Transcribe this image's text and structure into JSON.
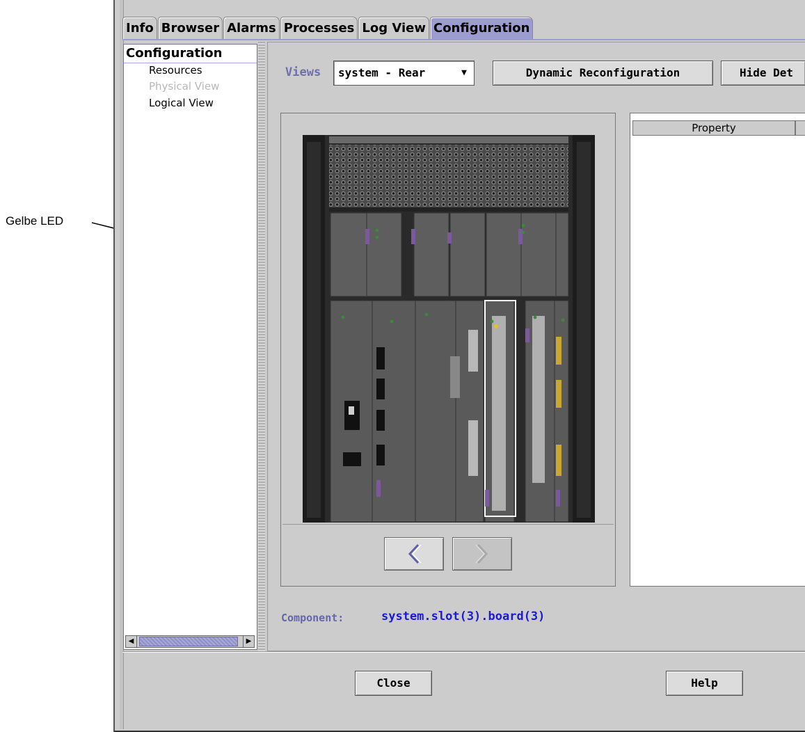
{
  "callout": {
    "text": "Gelbe LED"
  },
  "tabs": [
    {
      "label": "Info"
    },
    {
      "label": "Browser"
    },
    {
      "label": "Alarms"
    },
    {
      "label": "Processes"
    },
    {
      "label": "Log View"
    },
    {
      "label": "Configuration",
      "active": true
    }
  ],
  "tree": {
    "root": "Configuration",
    "items": [
      {
        "label": "Resources",
        "enabled": true
      },
      {
        "label": "Physical View",
        "enabled": false
      },
      {
        "label": "Logical View",
        "enabled": true
      }
    ]
  },
  "toolbar": {
    "views_label": "Views",
    "views_selected": "system - Rear",
    "dynamic_reconfig_label": "Dynamic Reconfiguration",
    "hide_details_label": "Hide Det"
  },
  "properties": {
    "column_property": "Property"
  },
  "component": {
    "label": "Component:",
    "value": "system.slot(3).board(3)"
  },
  "buttons": {
    "close_label": "Close",
    "help_label": "Help"
  },
  "colors": {
    "active_tab": "#9c9cd0",
    "component_value": "#1a1ad8",
    "led_yellow": "#e8c020"
  }
}
